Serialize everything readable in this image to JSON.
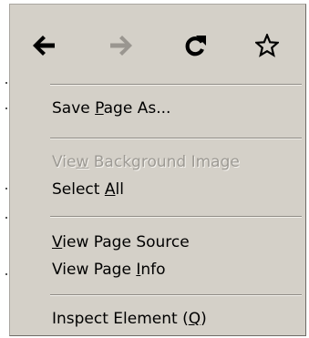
{
  "nav": {
    "back_icon": "arrow-left-icon",
    "forward_icon": "arrow-right-icon",
    "reload_icon": "reload-icon",
    "bookmark_icon": "star-icon"
  },
  "items": [
    {
      "pre": "Save ",
      "key": "P",
      "post": "age As...",
      "enabled": true
    },
    {
      "pre": "Vie",
      "key": "w",
      "post": " Background Image",
      "enabled": false
    },
    {
      "pre": "Select ",
      "key": "A",
      "post": "ll",
      "enabled": true
    },
    {
      "pre": "",
      "key": "V",
      "post": "iew Page Source",
      "enabled": true
    },
    {
      "pre": "View Page ",
      "key": "I",
      "post": "nfo",
      "enabled": true
    },
    {
      "pre": "Inspect Element (",
      "key": "Q",
      "post": ")",
      "enabled": true
    }
  ],
  "colors": {
    "menu_bg": "#d4d0c8",
    "disabled_text": "#9d9a94",
    "forward_disabled": "#9a9690"
  }
}
